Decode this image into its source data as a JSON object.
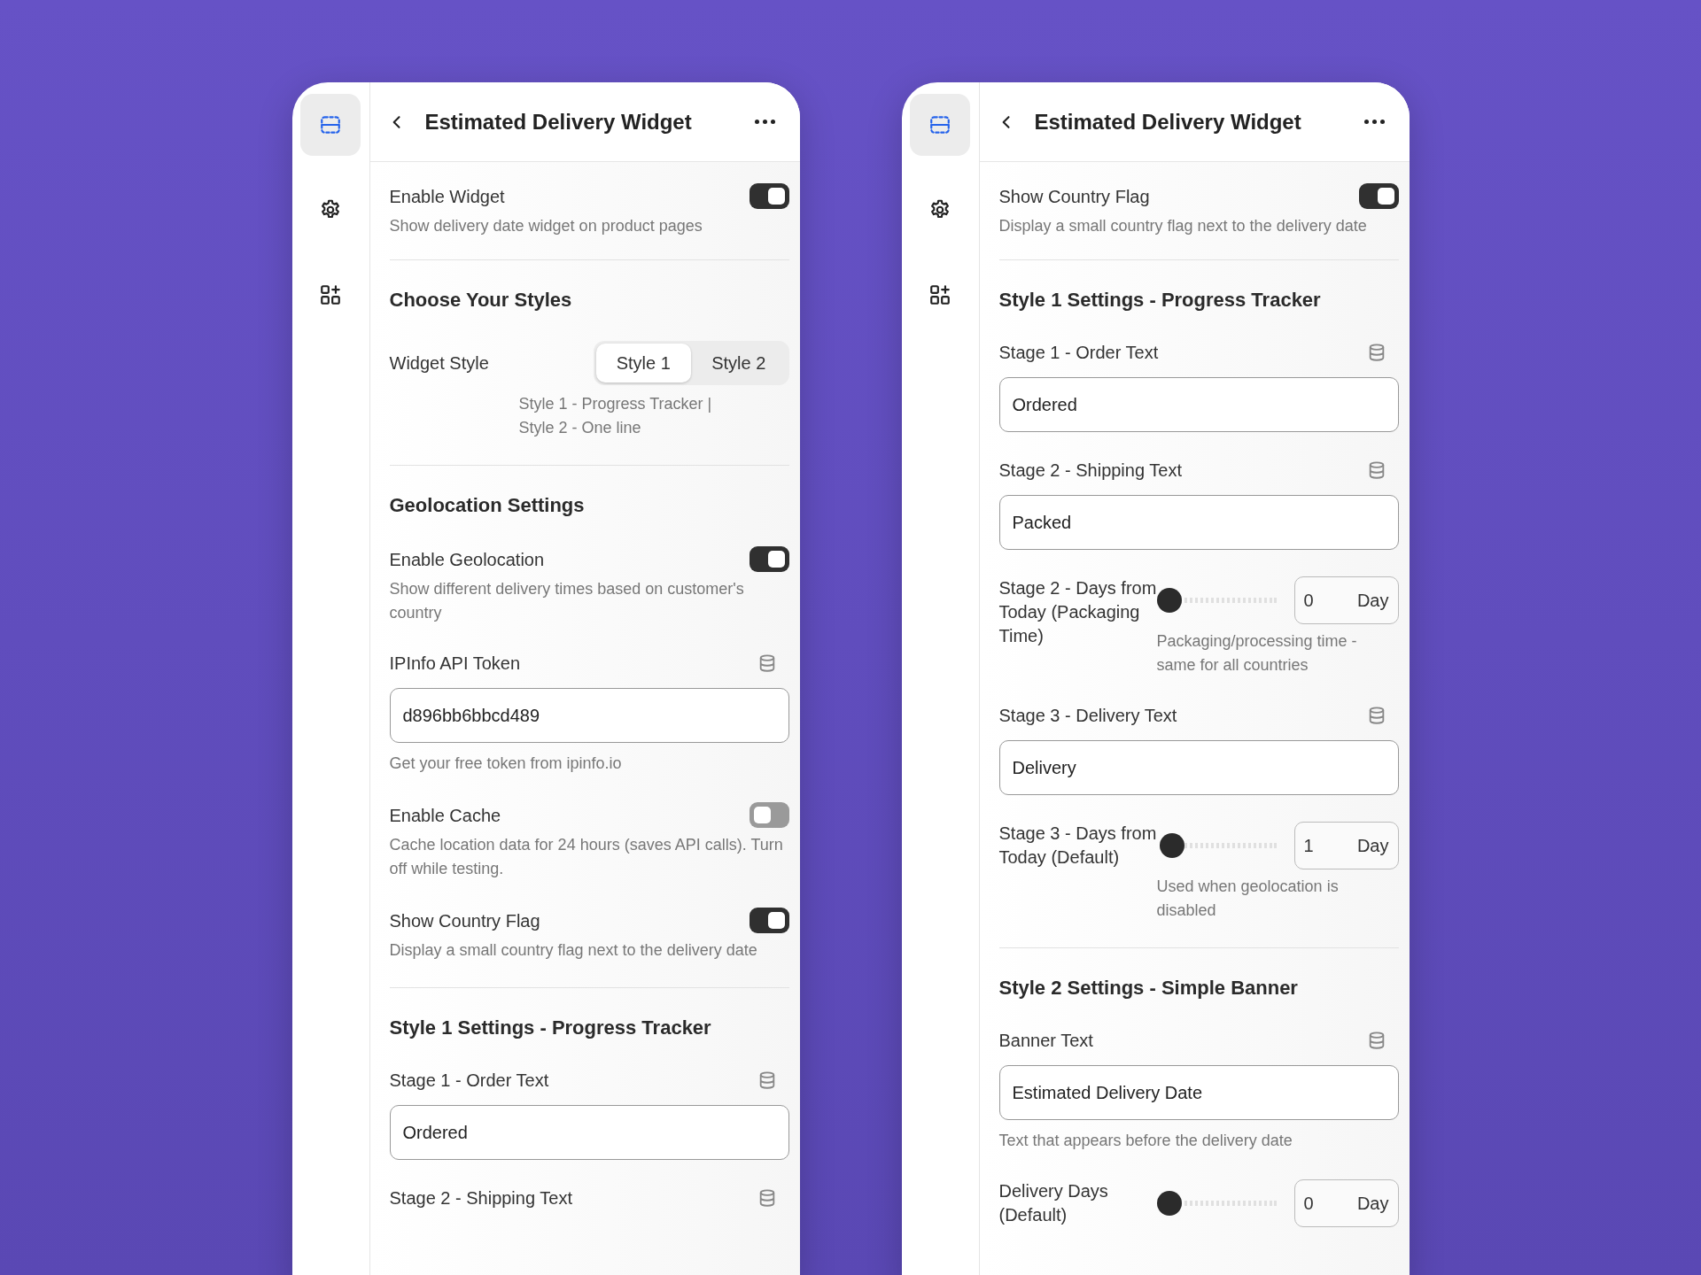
{
  "panels": [
    {
      "sidebar": [
        {
          "kind": "layout",
          "selected": true
        },
        {
          "kind": "settings",
          "selected": false
        },
        {
          "kind": "apps",
          "selected": false
        }
      ],
      "title": "Estimated Delivery Widget",
      "sections": [
        {
          "items": [
            {
              "kind": "toggle",
              "label": "Enable Widget",
              "description": "Show delivery date widget on product pages",
              "on": true
            }
          ]
        },
        {
          "heading": "Choose Your Styles",
          "items": [
            {
              "kind": "segmented",
              "label": "Widget Style",
              "options": [
                {
                  "label": "Style 1",
                  "selected": true
                },
                {
                  "label": "Style 2",
                  "selected": false
                }
              ],
              "hint": "Style 1 - Progress Tracker | Style 2 - One line"
            }
          ]
        },
        {
          "heading": "Geolocation Settings",
          "items": [
            {
              "kind": "toggle",
              "label": "Enable Geolocation",
              "description": "Show different delivery times based on customer's country",
              "on": true
            },
            {
              "kind": "text",
              "label": "IPInfo API Token",
              "value": "d896bb6bbcd489",
              "hint": "Get your free token from ipinfo.io"
            },
            {
              "kind": "toggle",
              "label": "Enable Cache",
              "description": "Cache location data for 24 hours (saves API calls). Turn off while testing.",
              "on": false
            },
            {
              "kind": "toggle",
              "label": "Show Country Flag",
              "description": "Display a small country flag next to the delivery date",
              "on": true
            }
          ]
        },
        {
          "heading": "Style 1 Settings - Progress Tracker",
          "items": [
            {
              "kind": "text",
              "label": "Stage 1 - Order Text",
              "value": "Ordered"
            },
            {
              "kind": "text",
              "label": "Stage 2 - Shipping Text"
            }
          ]
        }
      ]
    },
    {
      "sidebar": [
        {
          "kind": "layout",
          "selected": true
        },
        {
          "kind": "settings",
          "selected": false
        },
        {
          "kind": "apps",
          "selected": false
        }
      ],
      "title": "Estimated Delivery Widget",
      "sections": [
        {
          "items": [
            {
              "kind": "toggle",
              "label": "Show Country Flag",
              "description": "Display a small country flag next to the delivery date",
              "on": true
            }
          ]
        },
        {
          "heading": "Style 1 Settings - Progress Tracker",
          "items": [
            {
              "kind": "text",
              "label": "Stage 1 - Order Text",
              "value": "Ordered"
            },
            {
              "kind": "text",
              "label": "Stage 2 - Shipping Text",
              "value": "Packed"
            },
            {
              "kind": "slider",
              "label": "Stage 2 - Days from Today (Packaging Time)",
              "level": 0,
              "value": "0",
              "unit": "Day",
              "hint": "Packaging/processing time - same for all countries"
            },
            {
              "kind": "text",
              "label": "Stage 3 - Delivery Text",
              "value": "Delivery"
            },
            {
              "kind": "slider",
              "label": "Stage 3 - Days from Today (Default)",
              "level": 0.03,
              "value": "1",
              "unit": "Day",
              "hint": "Used when geolocation is disabled"
            }
          ]
        },
        {
          "heading": "Style 2 Settings - Simple Banner",
          "items": [
            {
              "kind": "text",
              "label": "Banner Text",
              "value": "Estimated Delivery Date",
              "hint": "Text that appears before the delivery date"
            },
            {
              "kind": "slider",
              "label": "Delivery Days (Default)",
              "level": 0,
              "value": "0",
              "unit": "Day"
            }
          ]
        }
      ]
    }
  ]
}
